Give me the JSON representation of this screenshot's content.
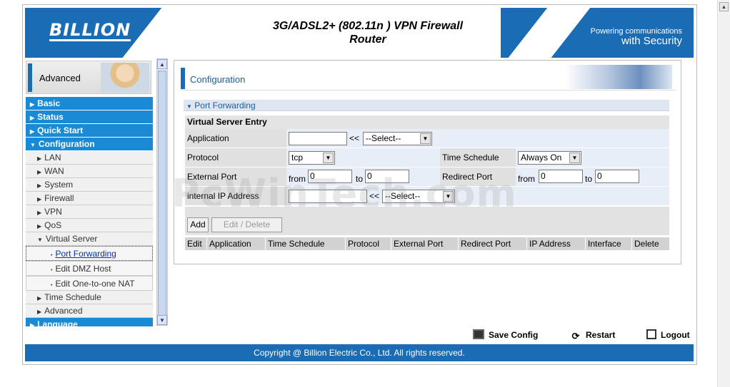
{
  "header": {
    "logo": "BILLION",
    "title_line1": "3G/ADSL2+ (802.11n ) VPN Firewall",
    "title_line2": "Router",
    "tagline_line1": "Powering communications",
    "tagline_line2": "with Security"
  },
  "sidebar": {
    "section_label": "Advanced",
    "items": [
      {
        "label": "Basic",
        "level": "main"
      },
      {
        "label": "Status",
        "level": "main"
      },
      {
        "label": "Quick Start",
        "level": "main"
      },
      {
        "label": "Configuration",
        "level": "main",
        "expanded": true
      },
      {
        "label": "LAN",
        "level": "sub"
      },
      {
        "label": "WAN",
        "level": "sub"
      },
      {
        "label": "System",
        "level": "sub"
      },
      {
        "label": "Firewall",
        "level": "sub"
      },
      {
        "label": "VPN",
        "level": "sub"
      },
      {
        "label": "QoS",
        "level": "sub"
      },
      {
        "label": "Virtual Server",
        "level": "sub",
        "expanded": true
      },
      {
        "label": "Port Forwarding",
        "level": "sub2",
        "active": true
      },
      {
        "label": "Edit DMZ Host",
        "level": "sub2"
      },
      {
        "label": "Edit One-to-one NAT",
        "level": "sub2"
      },
      {
        "label": "Time Schedule",
        "level": "sub"
      },
      {
        "label": "Advanced",
        "level": "sub"
      },
      {
        "label": "Language",
        "level": "main"
      }
    ]
  },
  "content": {
    "header_title": "Configuration",
    "section_title": "Port Forwarding",
    "entry_title": "Virtual Server Entry",
    "form": {
      "application_label": "Application",
      "application_value": "",
      "arrow_text": "<<",
      "application_select": "--Select--",
      "protocol_label": "Protocol",
      "protocol_value": "tcp",
      "time_schedule_label": "Time Schedule",
      "time_schedule_value": "Always On",
      "external_port_label": "External Port",
      "from_text": "from",
      "to_text": "to",
      "external_from": "0",
      "external_to": "0",
      "redirect_port_label": "Redirect Port",
      "redirect_from": "0",
      "redirect_to": "0",
      "ip_label": "internal IP Address",
      "ip_value": "",
      "ip_select": "--Select--"
    },
    "buttons": {
      "add": "Add",
      "edit_delete": "Edit / Delete"
    },
    "table_headers": [
      "Edit",
      "Application",
      "Time Schedule",
      "Protocol",
      "External Port",
      "Redirect Port",
      "IP Address",
      "Interface",
      "Delete"
    ]
  },
  "watermark": "PcWinTech.com",
  "actions": {
    "save": "Save Config",
    "restart": "Restart",
    "logout": "Logout"
  },
  "footer": "Copyright @ Billion Electric Co., Ltd. All rights reserved.",
  "colors": {
    "brand_blue": "#1a6cb5",
    "nav_blue": "#1a8ad4"
  }
}
